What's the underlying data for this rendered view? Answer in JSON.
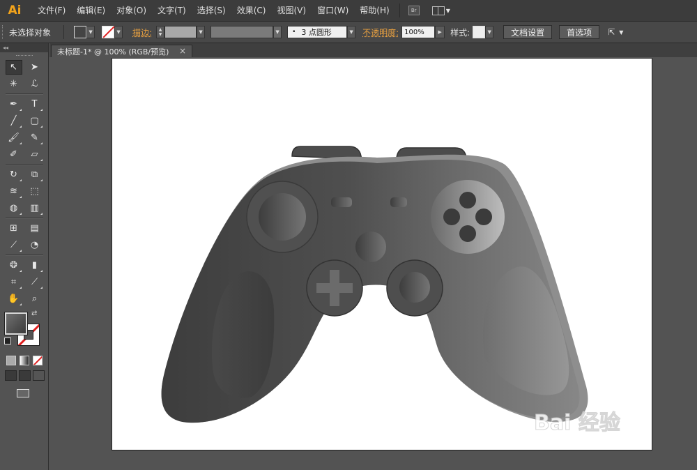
{
  "app": {
    "logo": "Ai",
    "menu": [
      "文件(F)",
      "编辑(E)",
      "对象(O)",
      "文字(T)",
      "选择(S)",
      "效果(C)",
      "视图(V)",
      "窗口(W)",
      "帮助(H)"
    ],
    "bridge_label": "Br"
  },
  "control_bar": {
    "selection_status": "未选择对象",
    "stroke_label": "描边:",
    "brush_value": "3 点圆形",
    "opacity_label": "不透明度:",
    "opacity_value": "100%",
    "style_label": "样式:",
    "doc_setup_button": "文档设置",
    "preferences_button": "首选项"
  },
  "document": {
    "tab_title": "未标题-1* @ 100% (RGB/预览)",
    "tab_close": "×"
  },
  "toolbar": {
    "collapse_label": "◂◂",
    "tools": [
      [
        "selection-tool-icon",
        "direct-selection-tool-icon"
      ],
      [
        "magic-wand-tool-icon",
        "lasso-tool-icon"
      ],
      [
        "pen-tool-icon",
        "type-tool-icon"
      ],
      [
        "line-segment-tool-icon",
        "rounded-rectangle-tool-icon"
      ],
      [
        "paintbrush-tool-icon",
        "pencil-tool-icon"
      ],
      [
        "blob-brush-tool-icon",
        "eraser-tool-icon"
      ],
      [
        "rotate-tool-icon",
        "scale-tool-icon"
      ],
      [
        "warp-tool-icon",
        "free-transform-tool-icon"
      ],
      [
        "shape-builder-tool-icon",
        "perspective-grid-tool-icon"
      ],
      [
        "mesh-tool-icon",
        "gradient-tool-icon"
      ],
      [
        "eyedropper-tool-icon",
        "blend-tool-icon"
      ],
      [
        "symbol-sprayer-tool-icon",
        "column-graph-tool-icon"
      ],
      [
        "artboard-tool-icon",
        "slice-tool-icon"
      ],
      [
        "hand-tool-icon",
        "zoom-tool-icon"
      ]
    ]
  },
  "colors": {
    "accent_logo": "#f2a31b",
    "stroke_none": "#e02020",
    "canvas_bg": "#535353",
    "artboard": "#ffffff"
  },
  "artwork": {
    "watermark": "Bai 经验"
  }
}
